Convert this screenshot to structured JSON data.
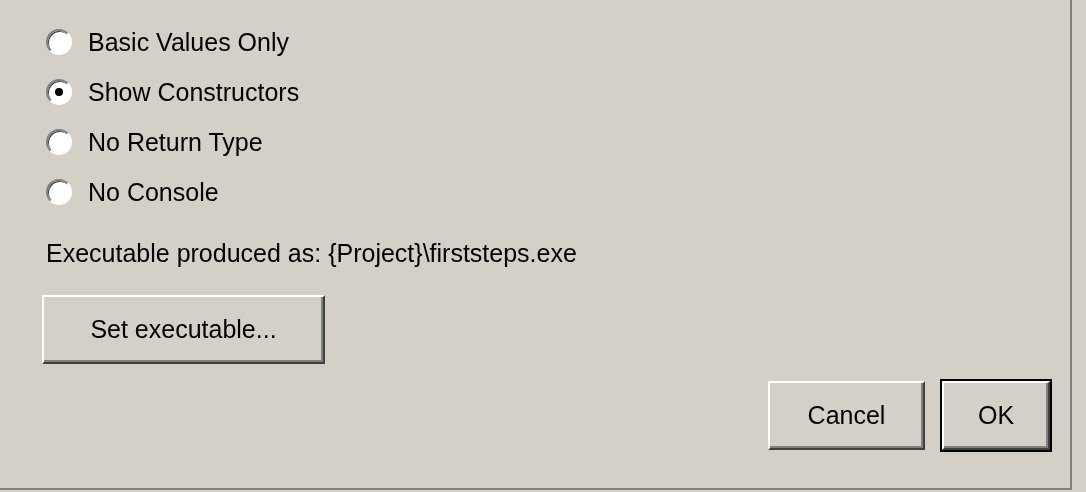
{
  "options": [
    {
      "label": "Basic Values Only",
      "selected": false
    },
    {
      "label": "Show Constructors",
      "selected": true
    },
    {
      "label": "No Return Type",
      "selected": false
    },
    {
      "label": "No Console",
      "selected": false
    }
  ],
  "executable_info": "Executable produced as: {Project}\\firststeps.exe",
  "set_button": {
    "label": "Set executable..."
  },
  "buttons": [
    {
      "label": "Cancel",
      "default": false
    },
    {
      "label": "OK",
      "default": true
    }
  ]
}
